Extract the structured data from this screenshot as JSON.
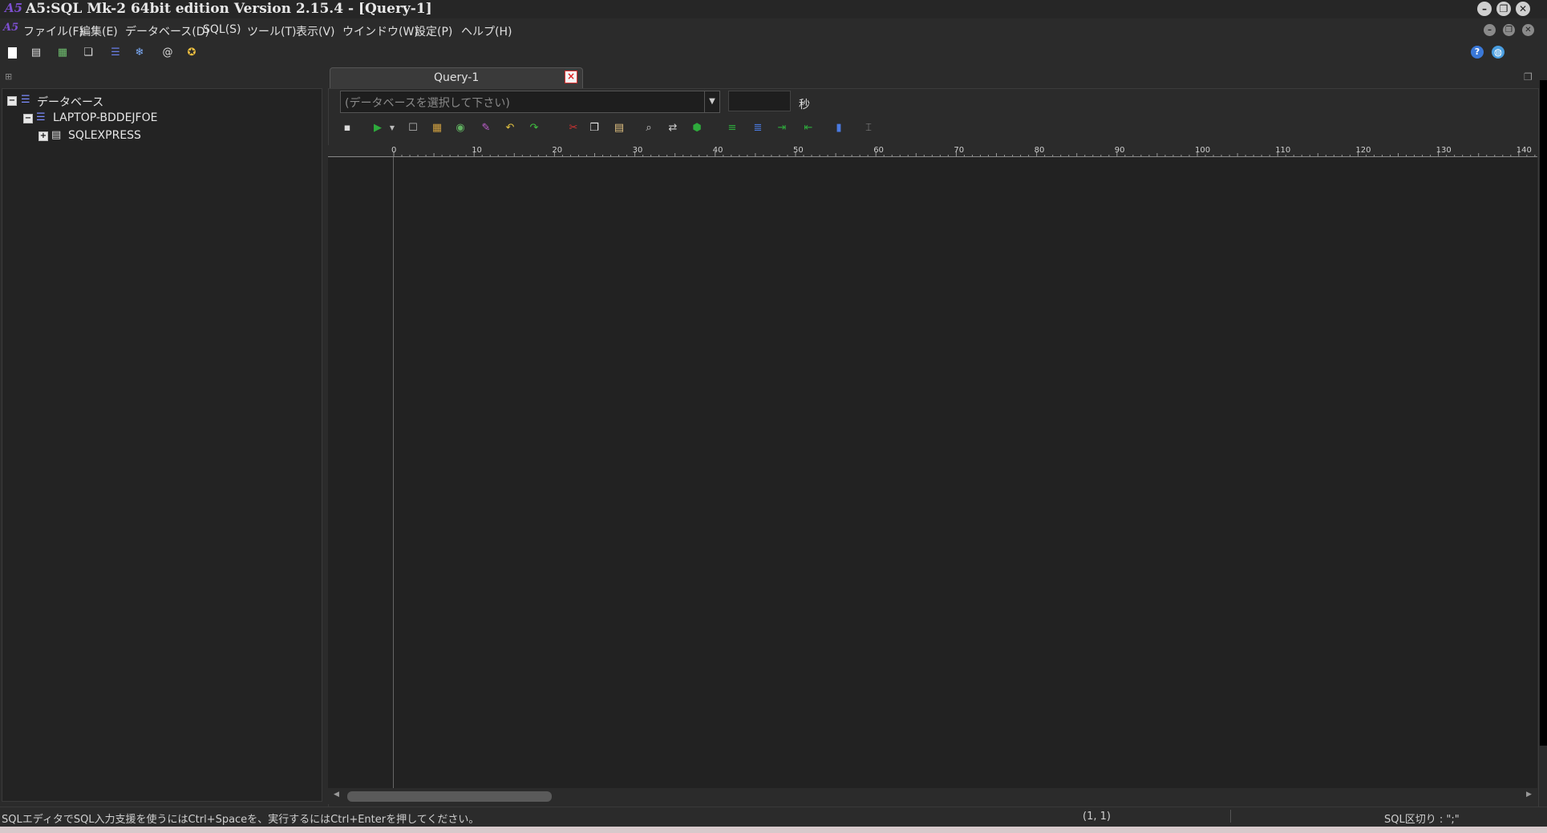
{
  "window": {
    "title": "A5:SQL Mk-2 64bit edition Version 2.15.4 - [Query-1]",
    "logo_text": "A5"
  },
  "menu": {
    "items": [
      "ファイル(F)",
      "編集(E)",
      "データベース(D)",
      "SQL(S)",
      "ツール(T)",
      "表示(V)",
      "ウインドウ(W)",
      "設定(P)",
      "ヘルプ(H)"
    ]
  },
  "tree": {
    "root_label": "データベース",
    "server_label": "LAPTOP-BDDEJFOE",
    "instance_label": "SQLEXPRESS",
    "root_toggle": "−",
    "server_toggle": "−",
    "instance_toggle": "+"
  },
  "query_tab": {
    "label": "Query-1",
    "close_glyph": "×"
  },
  "query_toolbar": {
    "db_select_placeholder": "(データベースを選択して下さい)",
    "timeout_value": "",
    "timeout_unit": "秒"
  },
  "ruler": {
    "labels": [
      "0",
      "10",
      "20",
      "30",
      "40",
      "50",
      "60",
      "70",
      "80",
      "90",
      "100",
      "110",
      "120",
      "130",
      "140"
    ]
  },
  "status": {
    "hint": "SQLエディタでSQL入力支援を使うにはCtrl+Spaceを、実行するにはCtrl+Enterを押してください。",
    "cursor_pos": "(1, 1)",
    "delimiter": "SQL区切り : \";\""
  },
  "colors": {
    "background": "#2b2b2b",
    "editor_bg": "#222222",
    "accent_purple": "#7d4fd0",
    "accent_green": "#2eaa3c",
    "accent_red": "#d33333"
  },
  "icons": {
    "main_toolbar": [
      "new-document-icon",
      "open-icon",
      "table-icon",
      "copy-db-icon",
      "database-icon",
      "snowflake-icon",
      "at-icon",
      "star-icon"
    ],
    "query_toolbar": [
      "save-icon",
      "run-icon",
      "stop-icon",
      "run-step-icon",
      "explain-icon",
      "clear-icon",
      "undo-icon",
      "redo-icon",
      "cut-icon",
      "copy-icon",
      "paste-icon",
      "find-icon",
      "replace-icon",
      "format-icon",
      "comment-icon",
      "uncomment-icon",
      "indent-icon",
      "unindent-icon",
      "bookmark-icon",
      "cursor-icon"
    ]
  }
}
